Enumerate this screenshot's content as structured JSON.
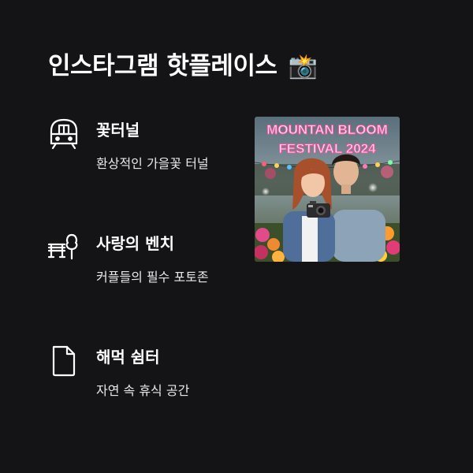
{
  "header": {
    "title": "인스타그램 핫플레이스",
    "emoji": "📸"
  },
  "places": [
    {
      "name": "꽃터널",
      "description": "환상적인 가을꽃 터널",
      "icon": "train-icon"
    },
    {
      "name": "사랑의 벤치",
      "description": "커플들의 필수 포토존",
      "icon": "bench-tree-icon"
    },
    {
      "name": "해먹 쉼터",
      "description": "자연 속 휴식 공간",
      "icon": "document-icon"
    }
  ],
  "photo": {
    "banner_line1": "MOUNTAN BLOOM",
    "banner_line2": "FESTIVAL 2024"
  }
}
